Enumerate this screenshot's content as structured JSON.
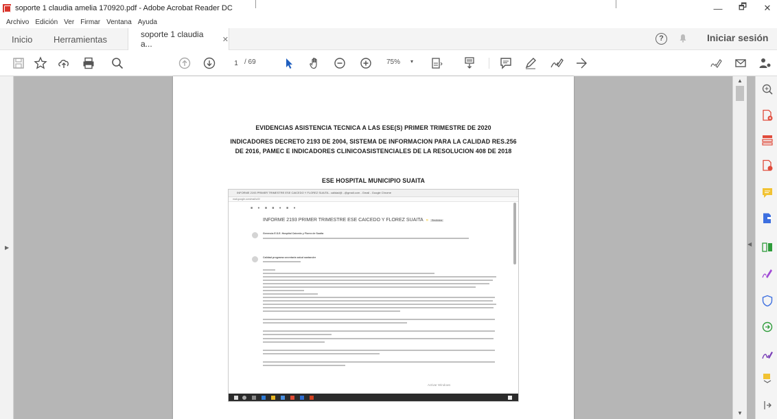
{
  "window": {
    "title": "soporte 1 claudia amelia 170920.pdf - Adobe Acrobat Reader DC",
    "minimize": "—",
    "maximize": "🗗",
    "close": "✕"
  },
  "menu": [
    "Archivo",
    "Edición",
    "Ver",
    "Firmar",
    "Ventana",
    "Ayuda"
  ],
  "tabs": {
    "home": "Inicio",
    "tools": "Herramientas",
    "document": "soporte 1 claudia a...",
    "document_close": "✕"
  },
  "header": {
    "help": "?",
    "signin": "Iniciar sesión"
  },
  "toolbar": {
    "page_current": "1",
    "page_total": "/ 69",
    "zoom": "75%",
    "zoom_arrow": "▾"
  },
  "document": {
    "heading1": "EVIDENCIAS ASISTENCIA TECNICA A LAS ESE(S) PRIMER TRIMESTRE DE 2020",
    "heading2_line1": "INDICADORES DECRETO 2193 DE 2004, SISTEMA DE INFORMACION PARA LA CALIDAD RES.256",
    "heading2_line2": "DE 2016, PAMEC E INDICADORES CLINICOASISTENCIALES DE LA RESOLUCION 408 DE 2018",
    "heading3": "ESE HOSPITAL MUNICIPIO SUAITA",
    "screenshot": {
      "window_title": "INFORME 2193 PRIMER TRIMESTRE ESE CAICEDO Y FLOREZ SUAITA - calidad@...@gmail.com - Gmail - Google Chrome",
      "address": "mail.google.com/mail/u/0/",
      "toolbar_icons": "■ ● ■ ■ ● ■ ●",
      "subject": "INFORME 2193 PRIMER TRIMESTRE ESE CAICEDO Y FLOREZ SUAITA",
      "subject_tag": "»",
      "subject_badge": "Recibidos",
      "sender1": "Gerencia E.S.E. Hospital Caicedo y Florez de Suaita",
      "sender2": "Calidad programa secretaria salud santander",
      "watermark": "Activar Windows"
    }
  },
  "scrollbar": {
    "up": "▲",
    "down": "▼",
    "collapse": "◀"
  },
  "left_panel": {
    "expand": "▶"
  }
}
